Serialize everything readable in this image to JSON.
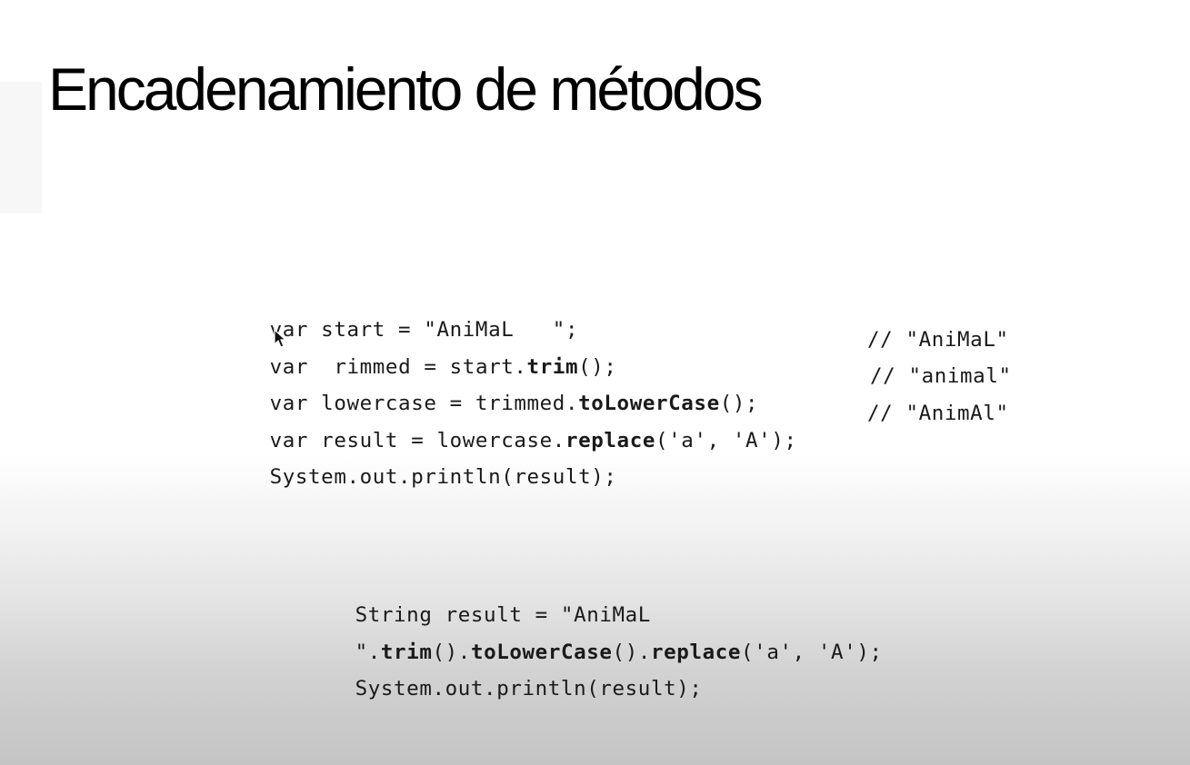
{
  "slide": {
    "title": "Encadenamiento de métodos"
  },
  "block1": {
    "line1": {
      "text": "var start = \"AniMaL   \";"
    },
    "line2": {
      "pre": "var ",
      "cursor_gap": " ",
      "mid": "rimmed = start.",
      "bold": "trim",
      "post": "();",
      "comment": "// \"AniMaL\""
    },
    "line3": {
      "pre": "var lowercase = trimmed.",
      "bold": "toLowerCase",
      "post": "();",
      "comment": "// \"animal\""
    },
    "line4": {
      "pre": "var result = lowercase.",
      "bold": "replace",
      "post": "('a', 'A');",
      "comment": "// \"AnimAl\""
    },
    "line5": {
      "text": "System.out.println(result);"
    }
  },
  "block2": {
    "line1": {
      "text": "String result = \"AniMaL"
    },
    "line2": {
      "pre": "\".",
      "bold1": "trim",
      "mid1": "().",
      "bold2": "toLowerCase",
      "mid2": "().",
      "bold3": "replace",
      "post": "('a', 'A');"
    },
    "line3": {
      "text": "System.out.println(result);"
    }
  },
  "icons": {
    "cursor": "mouse-pointer-icon"
  }
}
